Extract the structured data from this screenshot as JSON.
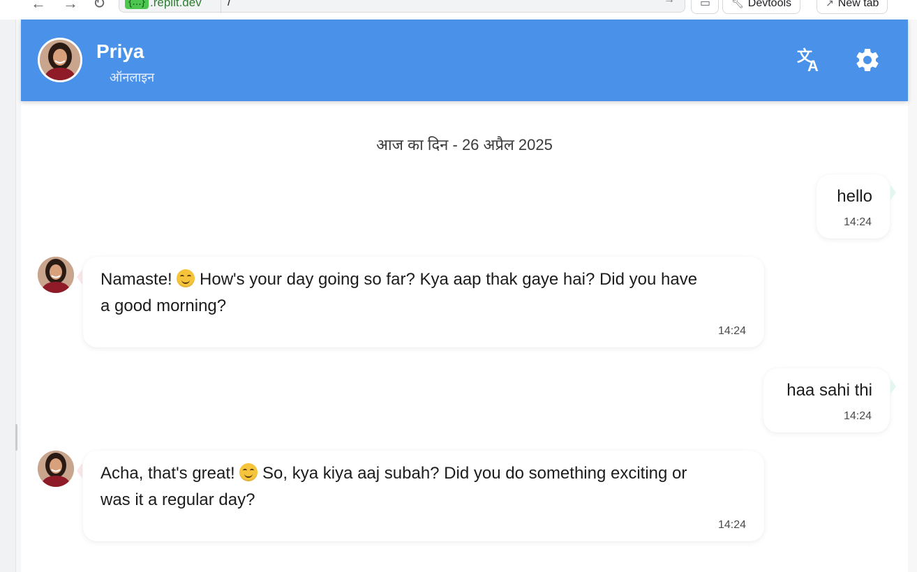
{
  "browser": {
    "url_host_prefix": "{...}",
    "url_host": ".replit.dev",
    "url_path": "/",
    "devtools_label": "Devtools",
    "new_tab_label": "New tab"
  },
  "header": {
    "contact_name": "Priya",
    "status": "ऑनलाइन",
    "translate_icon": "translate-icon",
    "settings_icon": "gear-icon",
    "color": "#4a92e9"
  },
  "chat": {
    "date_label": "आज का दिन - 26 अप्रैल 2025",
    "messages": [
      {
        "from": "me",
        "text": "hello",
        "time": "14:24"
      },
      {
        "from": "priya",
        "text_before": "Namaste! ",
        "emoji": "smiling-face-emoji",
        "text_line1_after": " How's your day going so far? Kya aap thak gaye hai? Did you have",
        "text_line2": "a good morning?",
        "time": "14:24"
      },
      {
        "from": "me",
        "text": "haa sahi thi",
        "time": "14:24"
      },
      {
        "from": "priya",
        "text_before": "Acha, that's great! ",
        "emoji": "smiling-face-emoji",
        "text_line1_after": " So, kya kiya aaj subah? Did you do something exciting or",
        "text_line2": "was it a regular day?",
        "time": "14:24"
      }
    ]
  }
}
